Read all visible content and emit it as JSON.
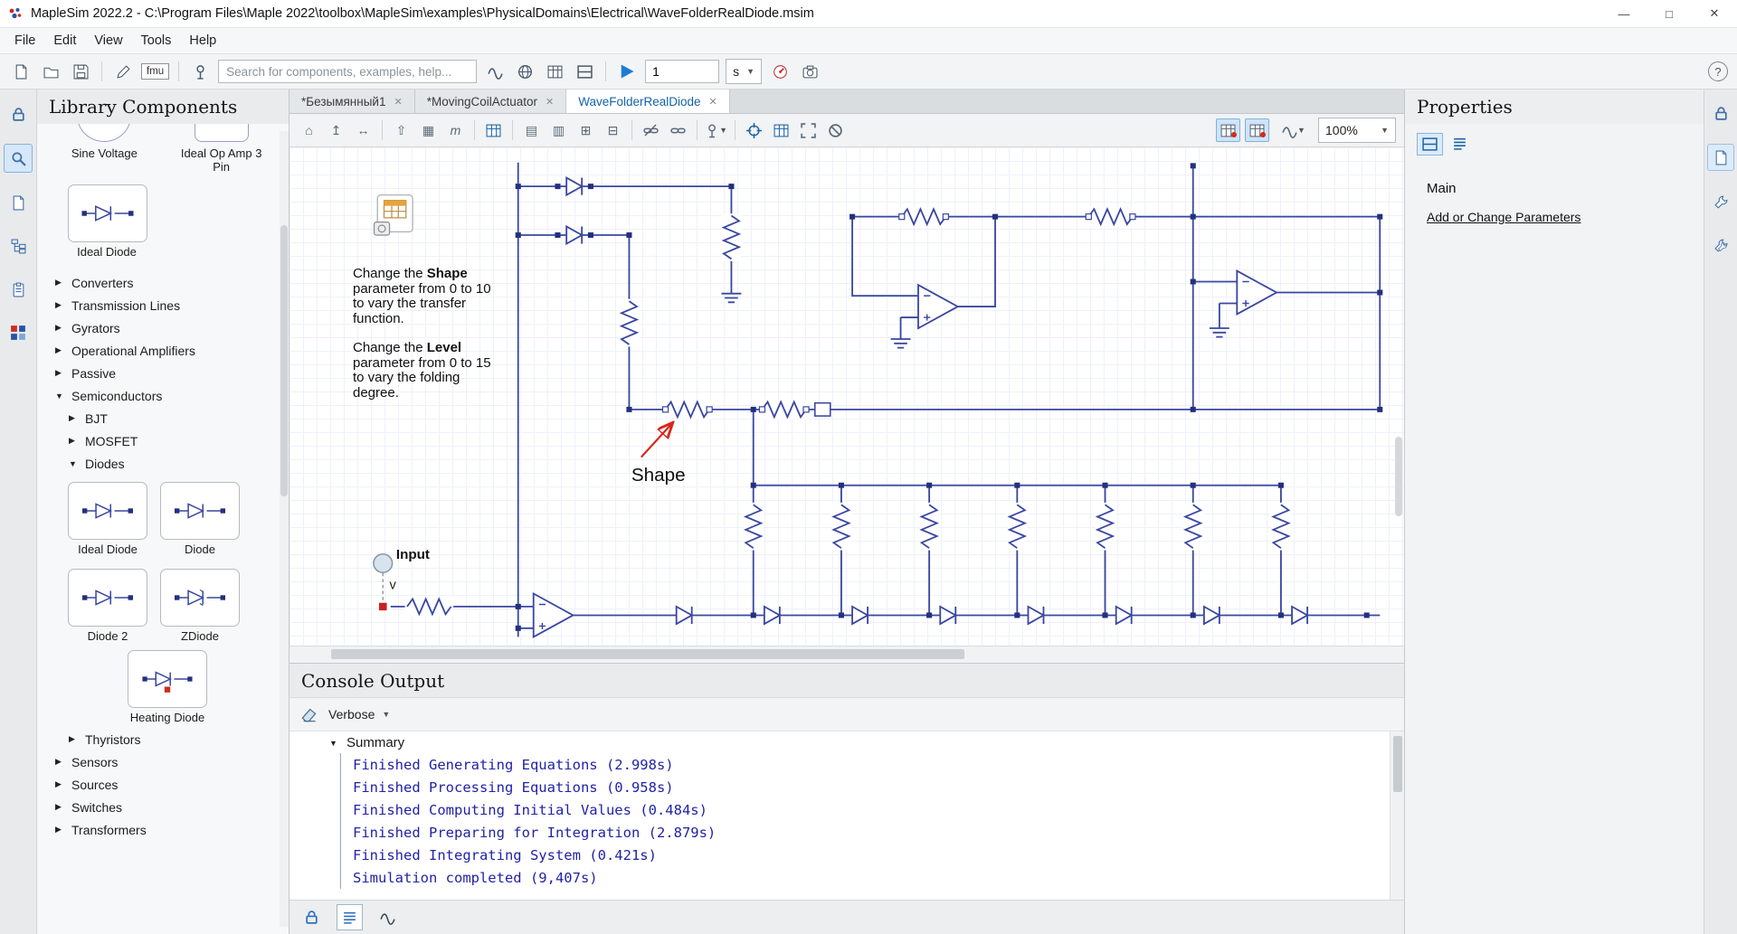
{
  "colors": {
    "accent_blue": "#1464a5",
    "circuit_blue": "#3a47a1",
    "node_blue": "#23307f",
    "console_text": "#2222a8",
    "annotation_red": "#d9251b"
  },
  "window": {
    "title": "MapleSim 2022.2 -  C:\\Program Files\\Maple 2022\\toolbox\\MapleSim\\examples\\PhysicalDomains\\Electrical\\WaveFolderRealDiode.msim",
    "minimize": "—",
    "maximize": "□",
    "close": "✕"
  },
  "menu": {
    "items": [
      {
        "label": "File"
      },
      {
        "label": "Edit"
      },
      {
        "label": "View"
      },
      {
        "label": "Tools"
      },
      {
        "label": "Help"
      }
    ]
  },
  "toolbar": {
    "fmu_label": "fmu",
    "search_placeholder": "Search for components, examples, help...",
    "duration_value": "1",
    "time_unit": "s",
    "help_glyph": "?"
  },
  "doc_tabs": [
    {
      "label": "*Безымянный1"
    },
    {
      "label": "*MovingCoilActuator"
    },
    {
      "label": "WaveFolderRealDiode"
    }
  ],
  "canvas_toolbar": {
    "zoom_value": "100%"
  },
  "library": {
    "title": "Library Components",
    "partial_items": [
      {
        "label": "Sine Voltage"
      },
      {
        "label": "Ideal Op Amp 3 Pin"
      }
    ],
    "featured_item": {
      "label": "Ideal Diode"
    },
    "tree": [
      {
        "label": "Converters"
      },
      {
        "label": "Transmission Lines"
      },
      {
        "label": "Gyrators"
      },
      {
        "label": "Operational Amplifiers"
      },
      {
        "label": "Passive"
      },
      {
        "label": "Semiconductors"
      },
      {
        "label": "BJT"
      },
      {
        "label": "MOSFET"
      },
      {
        "label": "Diodes"
      }
    ],
    "diode_components": [
      {
        "label": "Ideal Diode"
      },
      {
        "label": "Diode"
      },
      {
        "label": "Diode 2"
      },
      {
        "label": "ZDiode"
      },
      {
        "label": "Heating Diode"
      }
    ],
    "tree_after": [
      {
        "label": "Thyristors"
      },
      {
        "label": "Sensors"
      },
      {
        "label": "Sources"
      },
      {
        "label": "Switches"
      },
      {
        "label": "Transformers"
      }
    ]
  },
  "canvas": {
    "note1": {
      "pre": "Change the ",
      "bold": "Shape",
      "post": " parameter from 0 to 10 to vary the transfer function."
    },
    "note2": {
      "pre": "Change the ",
      "bold": "Level",
      "post": " parameter from 0 to 15 to vary the folding degree."
    },
    "shape_label": "Shape",
    "input_label": "Input",
    "input_signal": "v"
  },
  "console": {
    "title": "Console Output",
    "filter_value": "Verbose",
    "group_label": "Summary",
    "lines": [
      "Finished Generating Equations (2.998s)",
      "Finished Processing Equations (0.958s)",
      "Finished Computing Initial Values (0.484s)",
      "Finished Preparing for Integration (2.879s)",
      "Finished Integrating System (0.421s)",
      "Simulation completed (9,407s)"
    ]
  },
  "properties": {
    "title": "Properties",
    "section_label": "Main",
    "link_label": "Add or Change Parameters"
  }
}
